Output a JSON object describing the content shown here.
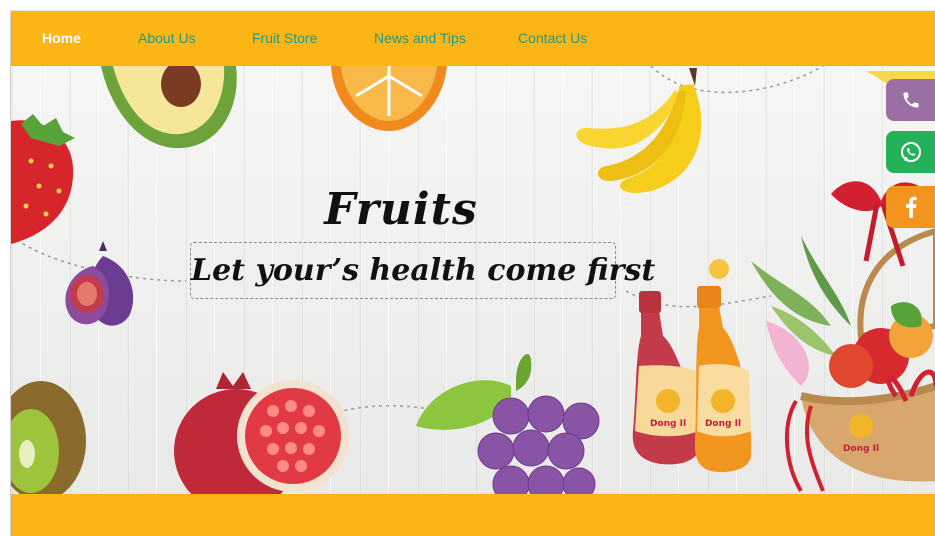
{
  "nav": {
    "items": [
      {
        "label": "Home",
        "active": true
      },
      {
        "label": "About Us",
        "active": false
      },
      {
        "label": "Fruit Store",
        "active": false
      },
      {
        "label": "News and Tips",
        "active": false
      },
      {
        "label": "Contact Us",
        "active": false
      }
    ]
  },
  "hero": {
    "title": "Fruits",
    "tagline": "Let your’s health come first",
    "brand_label": "Dong Il"
  },
  "side_buttons": [
    {
      "name": "phone-icon",
      "color": "#9b6fa3"
    },
    {
      "name": "whatsapp-icon",
      "color": "#23b25a"
    },
    {
      "name": "facebook-icon",
      "color": "#f3941e"
    }
  ],
  "colors": {
    "nav_bg": "#fbb615",
    "nav_link": "#1e9a8a",
    "nav_active": "#ffffff"
  }
}
